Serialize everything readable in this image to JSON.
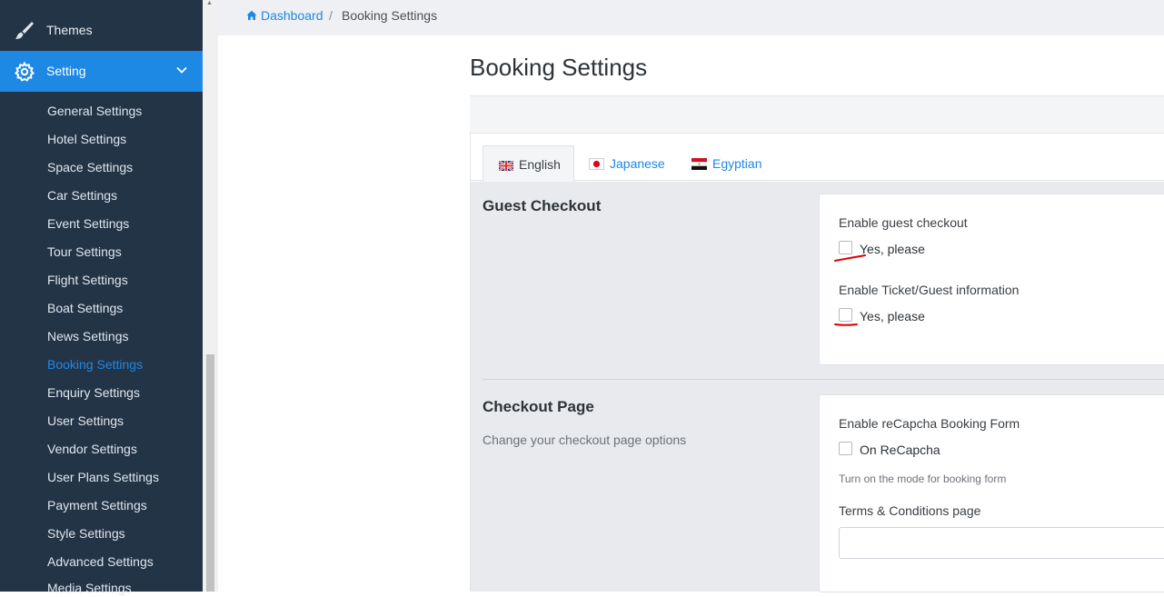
{
  "sidebar": {
    "themes_label": "Themes",
    "setting_label": "Setting",
    "items": [
      {
        "label": "General Settings"
      },
      {
        "label": "Hotel Settings"
      },
      {
        "label": "Space Settings"
      },
      {
        "label": "Car Settings"
      },
      {
        "label": "Event Settings"
      },
      {
        "label": "Tour Settings"
      },
      {
        "label": "Flight Settings"
      },
      {
        "label": "Boat Settings"
      },
      {
        "label": "News Settings"
      },
      {
        "label": "Booking Settings",
        "active": true
      },
      {
        "label": "Enquiry Settings"
      },
      {
        "label": "User Settings"
      },
      {
        "label": "Vendor Settings"
      },
      {
        "label": "User Plans Settings"
      },
      {
        "label": "Payment Settings"
      },
      {
        "label": "Style Settings"
      },
      {
        "label": "Advanced Settings"
      },
      {
        "label": "Media Settings"
      }
    ],
    "colors": {
      "background": "#243447",
      "active_item": "#1e88e5",
      "active_link": "#1e88e5"
    }
  },
  "breadcrumb": {
    "home_label": "Dashboard",
    "separator": "/",
    "current": "Booking Settings",
    "home_icon": "home-icon"
  },
  "page": {
    "title": "Booking Settings"
  },
  "tabs": [
    {
      "label": "English",
      "flag": "uk-flag-icon",
      "active": true
    },
    {
      "label": "Japanese",
      "flag": "japan-flag-icon",
      "active": false
    },
    {
      "label": "Egyptian",
      "flag": "egypt-flag-icon",
      "active": false
    }
  ],
  "guest_checkout": {
    "title": "Guest Checkout",
    "enable_guest_label": "Enable guest checkout",
    "enable_guest_option": "Yes, please",
    "enable_guest_checked": false,
    "ticket_info_label": "Enable Ticket/Guest information",
    "ticket_info_option": "Yes, please",
    "ticket_info_checked": false
  },
  "checkout_page": {
    "title": "Checkout Page",
    "description": "Change your checkout page options",
    "recaptcha_label": "Enable reCapcha Booking Form",
    "recaptcha_option": "On ReCapcha",
    "recaptcha_checked": false,
    "recaptcha_help": "Turn on the mode for booking form",
    "terms_label": "Terms & Conditions page",
    "terms_value": ""
  },
  "annotation_color": "#e00000"
}
